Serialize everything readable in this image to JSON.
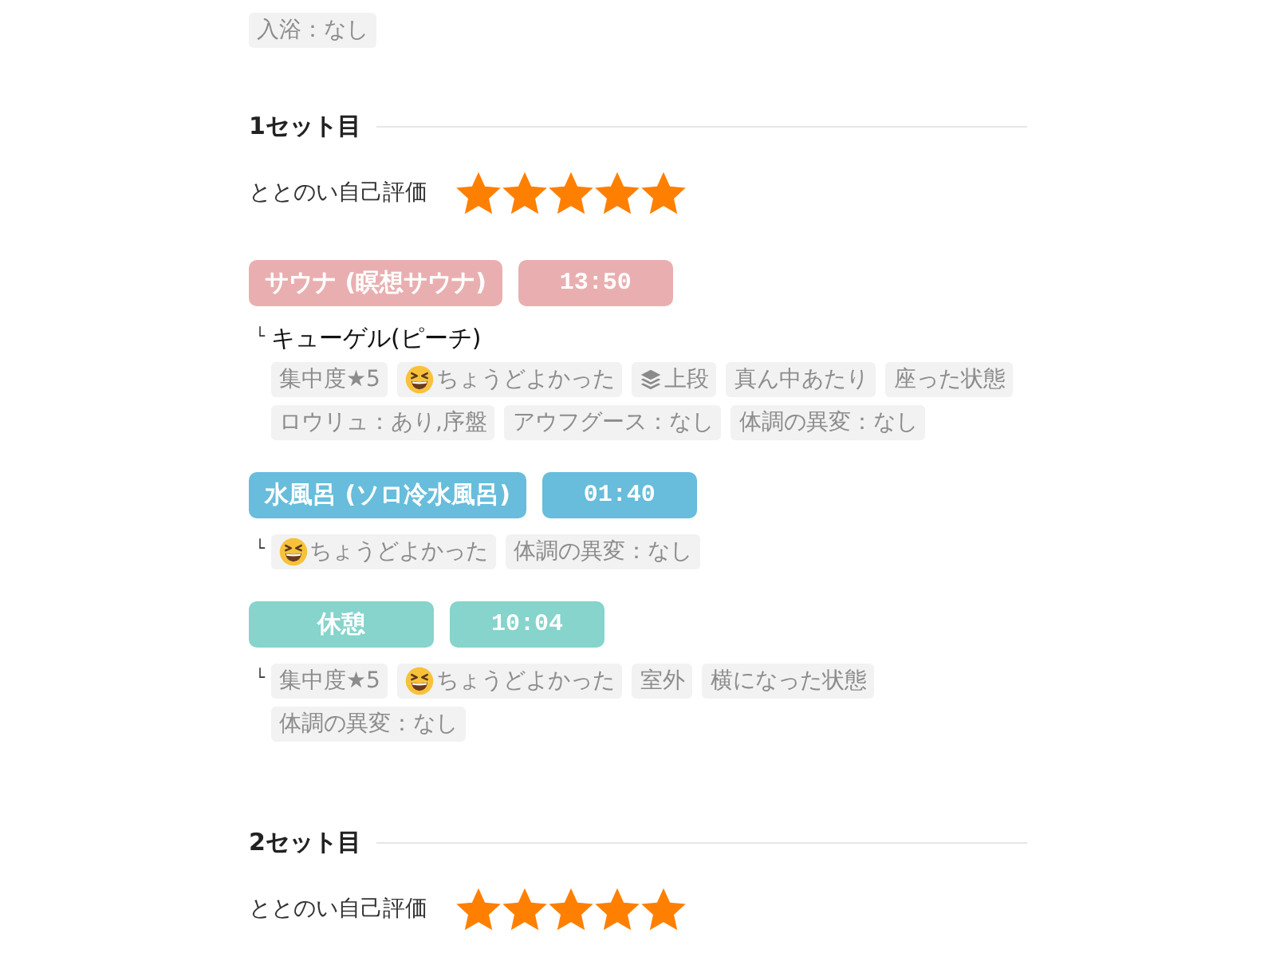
{
  "top_tags": [
    "入浴：なし"
  ],
  "sets": [
    {
      "title": "1セット目",
      "rating_label": "ととのい自己評価",
      "stars": 5,
      "steps": [
        {
          "name": "サウナ (瞑想サウナ)",
          "time": "13:50",
          "color": "#e9afb0",
          "branch": "└",
          "detail": "キューゲル(ピーチ)",
          "tags": [
            {
              "kind": "text",
              "text": "集中度★5"
            },
            {
              "kind": "emoji",
              "text": "ちょうどよかった"
            },
            {
              "kind": "layers",
              "text": "上段"
            },
            {
              "kind": "text",
              "text": "真ん中あたり"
            },
            {
              "kind": "text",
              "text": "座った状態"
            },
            {
              "kind": "text",
              "text": "ロウリュ：あり,序盤"
            },
            {
              "kind": "text",
              "text": "アウフグース：なし"
            },
            {
              "kind": "text",
              "text": "体調の異変：なし"
            }
          ]
        },
        {
          "name": "水風呂 (ソロ冷水風呂)",
          "time": "01:40",
          "color": "#67bddb",
          "branch": "└",
          "tags": [
            {
              "kind": "emoji",
              "text": "ちょうどよかった"
            },
            {
              "kind": "text",
              "text": "体調の異変：なし"
            }
          ]
        },
        {
          "name": "休憩",
          "time": "10:04",
          "color": "#86d4cc",
          "branch": "└",
          "tags": [
            {
              "kind": "text",
              "text": "集中度★5"
            },
            {
              "kind": "emoji",
              "text": "ちょうどよかった"
            },
            {
              "kind": "text",
              "text": "室外"
            },
            {
              "kind": "text",
              "text": "横になった状態"
            },
            {
              "kind": "text",
              "text": "体調の異変：なし"
            }
          ]
        }
      ]
    },
    {
      "title": "2セット目",
      "rating_label": "ととのい自己評価",
      "stars": 5
    }
  ]
}
